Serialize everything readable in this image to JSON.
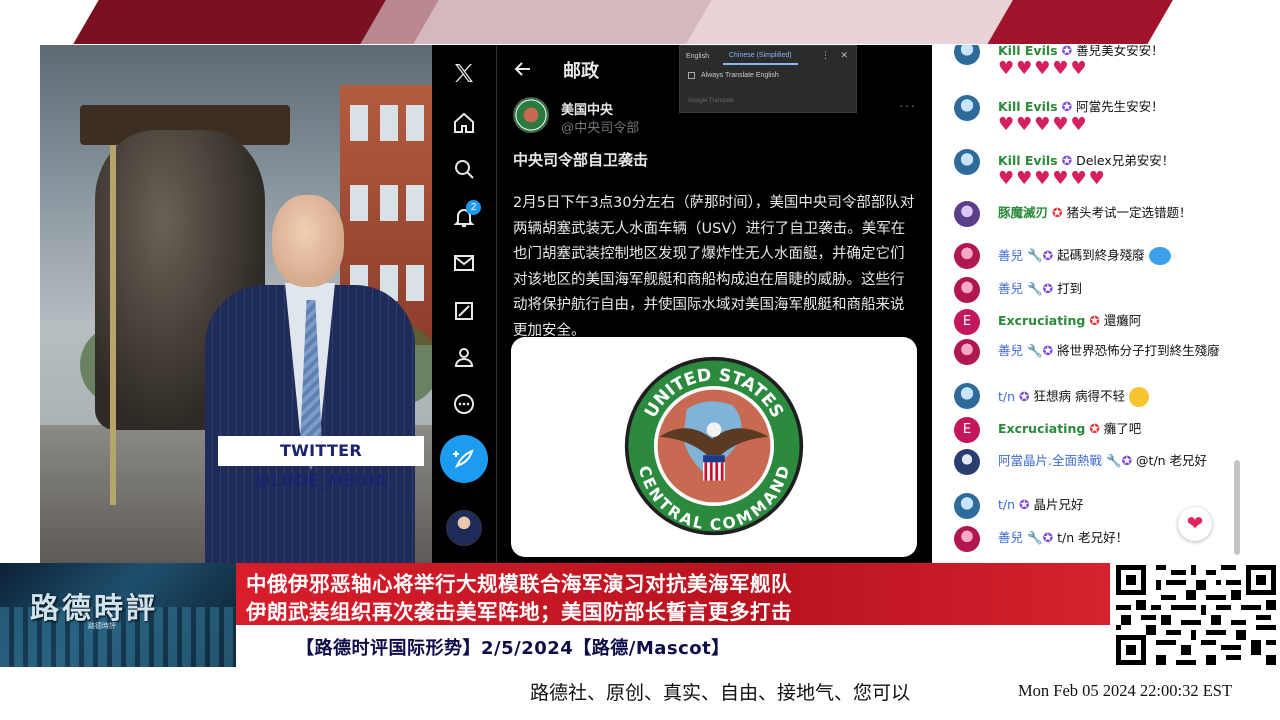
{
  "overlay": {
    "twitter_tag": "TWITTER  @LUDE_MEDIA"
  },
  "x_app": {
    "nav": {
      "notification_count": "2"
    },
    "header_title": "邮政",
    "translate_popup": {
      "tab_source": "English",
      "tab_target": "Chinese (Simplified)",
      "option_label": "Always Translate English",
      "provider": "Google Translate"
    },
    "tweet": {
      "account_name": "美国中央",
      "handle": "@中央司令部",
      "more": "···",
      "heading": "中央司令部自卫袭击",
      "body": "2月5日下午3点30分左右（萨那时间），美国中央司令部部队对两辆胡塞武装无人水面车辆（USV）进行了自卫袭击。美军在也门胡塞武装控制地区发现了爆炸性无人水面艇，并确定它们对该地区的美国海军舰艇和商船构成迫在眉睫的威胁。这些行动将保护航行自由，并使国际水域对美国海军舰艇和商船来说更加安全。",
      "logo_top_text": "UNITED STATES",
      "logo_bottom_text": "CENTRAL COMMAND"
    }
  },
  "chat": {
    "messages": [
      {
        "name": "Kill Evils",
        "text": "善兒美女安安！",
        "hearts": "♥♥♥♥♥"
      },
      {
        "name": "Kill Evils",
        "text": "阿當先生安安！",
        "hearts": "♥♥♥♥♥"
      },
      {
        "name": "Kill Evils",
        "text": "Delex兄弟安安！",
        "hearts": "♥♥♥♥♥♥"
      },
      {
        "name": "豚魔滅刃",
        "text": "猪头考试一定选错题！"
      },
      {
        "name": "善兒",
        "text": "起碼到終身殘廢"
      },
      {
        "name": "善兒",
        "text": "打到"
      },
      {
        "name": "Excruciating",
        "text": "還癱阿",
        "avatar_letter": "E"
      },
      {
        "name": "善兒",
        "text": "將世界恐怖分子打到終生殘廢"
      },
      {
        "name": "t/n",
        "text": "狂想病 病得不轻"
      },
      {
        "name": "Excruciating",
        "text": "癱了吧",
        "avatar_letter": "E"
      },
      {
        "name": "阿當晶片.全面熱戰",
        "text": "@t/n 老兄好"
      },
      {
        "name": "t/n",
        "text": "晶片兄好"
      },
      {
        "name": "善兒",
        "text": "t/n 老兄好！"
      }
    ]
  },
  "lower_third": {
    "brand_name": "路德時評",
    "brand_sub": "路德時評",
    "headline_1": "中俄伊邪恶轴心将举行大规模联合海军演习对抗美海军舰队",
    "headline_2": "伊朗武装组织再次袭击美军阵地；美国防部长誓言更多打击",
    "subtitle": "【路德时评国际形势】2/5/2024【路德/Mascot】"
  },
  "ticker": {
    "text": "路德社、原创、真实、自由、接地气、您可以",
    "clock": "Mon Feb 05 2024 22:00:32 EST"
  },
  "colors": {
    "headline_red": "#d81d2b",
    "x_accent": "#1d9bf0",
    "chat_name_green": "#2c8a3a",
    "subtitle_navy": "#0d0d4a"
  }
}
